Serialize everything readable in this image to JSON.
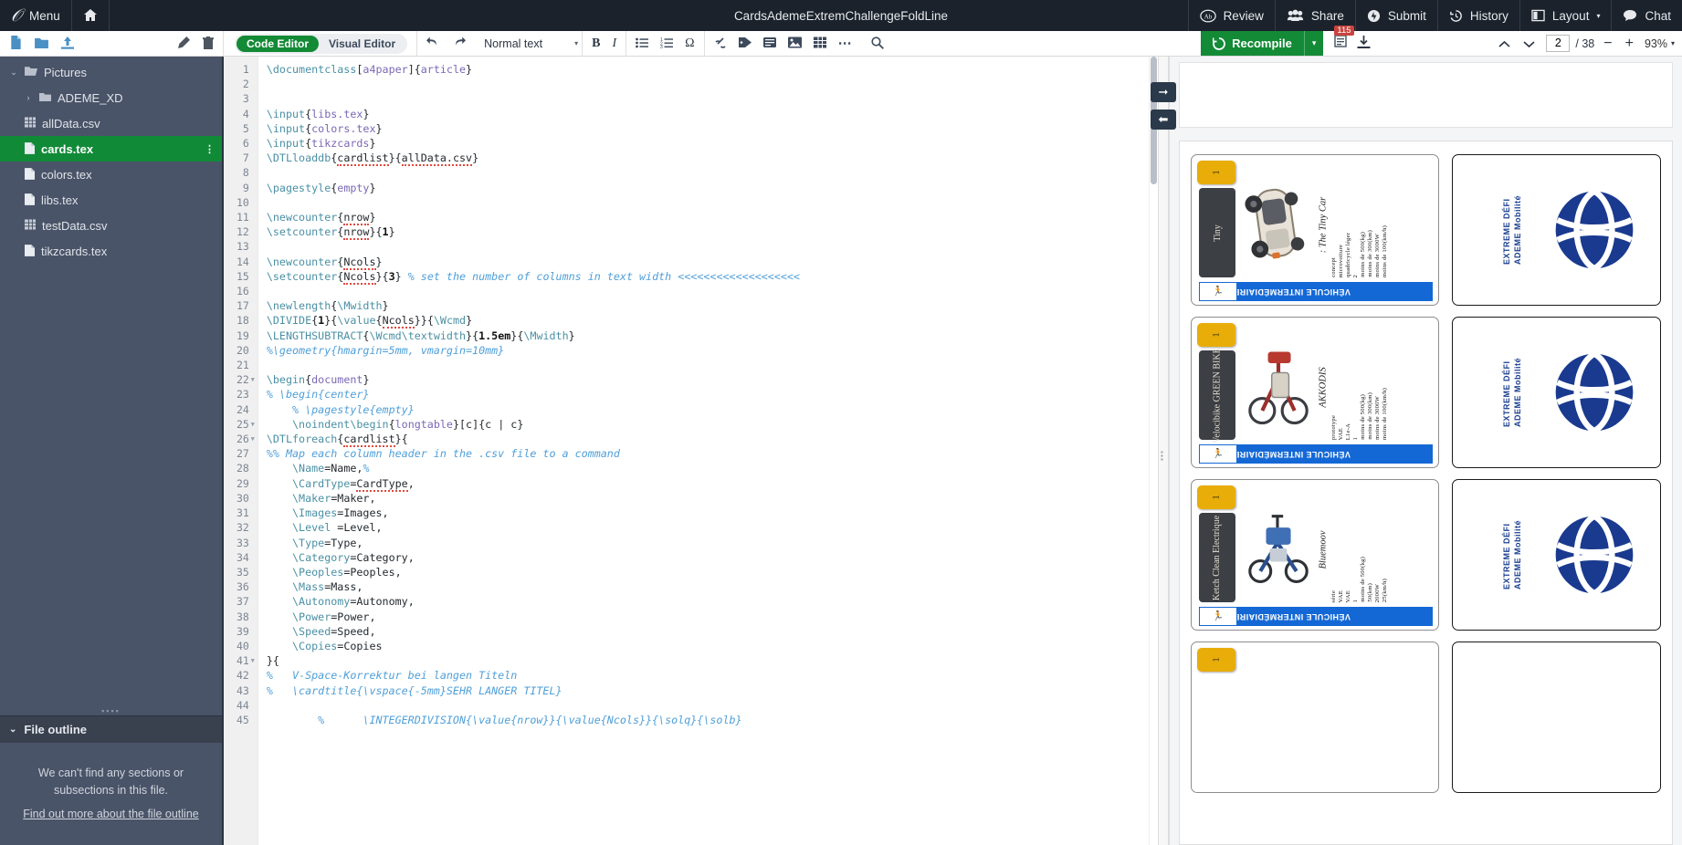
{
  "topnav": {
    "logo_icon": "overleaf-logo-icon",
    "menu_label": "Menu",
    "home_icon": "home-icon",
    "project_title": "CardsAdemeExtremChallengeFoldLine",
    "right_items": [
      {
        "label": "Review",
        "icon": "review-icon"
      },
      {
        "label": "Share",
        "icon": "share-people-icon"
      },
      {
        "label": "Submit",
        "icon": "submit-icon"
      },
      {
        "label": "History",
        "icon": "history-clock-icon"
      },
      {
        "label": "Layout",
        "icon": "layout-columns-icon",
        "caret": "▾"
      },
      {
        "label": "Chat",
        "icon": "chat-bubble-icon"
      }
    ]
  },
  "toolbar": {
    "left_icons": [
      "new-file-icon",
      "new-folder-icon",
      "upload-icon"
    ],
    "edit_icons": [
      "rename-pencil-icon",
      "delete-trash-icon"
    ],
    "editor_modes": [
      {
        "label": "Code Editor",
        "active": true
      },
      {
        "label": "Visual Editor",
        "active": false
      }
    ],
    "undo_icon": "undo-icon",
    "redo_icon": "redo-icon",
    "format_select": "Normal text",
    "format_caret": "▾",
    "bold_label": "B",
    "italic_label": "I",
    "list_icons": [
      "bullet-list-icon",
      "numbered-list-icon",
      "omega-symbol-icon"
    ],
    "insert_icons": [
      "link-icon",
      "tag-icon",
      "citation-icon",
      "image-icon",
      "table-icon"
    ],
    "more_icon": "ellipsis-icon",
    "search_icon": "search-icon",
    "recompile_label": "Recompile",
    "recompile_icon": "recompile-refresh-icon",
    "recompile_caret": "▾",
    "error_count": "115",
    "log_icon": "compile-log-icon",
    "download_icon": "download-pdf-icon",
    "page_prev_icon": "chevron-up-icon",
    "page_next_icon": "chevron-down-icon",
    "page_current": "2",
    "page_total": "/ 38",
    "zoom_out": "−",
    "zoom_in": "+",
    "zoom_level": "93%",
    "zoom_caret": "▾"
  },
  "sidebar": {
    "files": [
      {
        "name": "Pictures",
        "icon": "folder-open-icon",
        "caret": "⌄",
        "indent": false,
        "selected": false
      },
      {
        "name": "ADEME_XD",
        "icon": "folder-icon",
        "caret": "›",
        "indent": true,
        "selected": false
      },
      {
        "name": "allData.csv",
        "icon": "table-file-icon",
        "caret": "",
        "indent": false,
        "selected": false
      },
      {
        "name": "cards.tex",
        "icon": "tex-file-icon",
        "caret": "",
        "indent": false,
        "selected": true,
        "menu": "⋮"
      },
      {
        "name": "colors.tex",
        "icon": "tex-file-icon",
        "caret": "",
        "indent": false,
        "selected": false
      },
      {
        "name": "libs.tex",
        "icon": "tex-file-icon",
        "caret": "",
        "indent": false,
        "selected": false
      },
      {
        "name": "testData.csv",
        "icon": "table-file-icon",
        "caret": "",
        "indent": false,
        "selected": false
      },
      {
        "name": "tikzcards.tex",
        "icon": "tex-file-icon",
        "caret": "",
        "indent": false,
        "selected": false
      }
    ],
    "outline": {
      "header": "File outline",
      "caret": "⌄",
      "empty_line1": "We can't find any sections or",
      "empty_line2": "subsections in this file.",
      "link": "Find out more about the file outline"
    }
  },
  "editor": {
    "lines": [
      {
        "n": 1,
        "fold": false,
        "html": "<span class='cmd'>\\documentclass</span>[<span class='arg'>a4paper</span>]{<span class='arg'>article</span>}"
      },
      {
        "n": 2,
        "fold": false,
        "html": ""
      },
      {
        "n": 3,
        "fold": false,
        "html": ""
      },
      {
        "n": 4,
        "fold": false,
        "html": "<span class='cmd'>\\input</span>{<span class='arg'>libs.tex</span>}"
      },
      {
        "n": 5,
        "fold": false,
        "html": "<span class='cmd'>\\input</span>{<span class='arg'>colors.tex</span>}"
      },
      {
        "n": 6,
        "fold": false,
        "html": "<span class='cmd'>\\input</span>{<span class='arg'>tikzcards</span>}"
      },
      {
        "n": 7,
        "fold": false,
        "html": "<span class='cmd'>\\DTLloaddb</span>{<span class='sp'>cardlist</span>}{<span class='sp'>allData.csv</span>}"
      },
      {
        "n": 8,
        "fold": false,
        "html": ""
      },
      {
        "n": 9,
        "fold": false,
        "html": "<span class='cmd'>\\pagestyle</span>{<span class='arg'>empty</span>}"
      },
      {
        "n": 10,
        "fold": false,
        "html": ""
      },
      {
        "n": 11,
        "fold": false,
        "html": "<span class='cmd'>\\newcounter</span>{<span class='sp'>nrow</span>}"
      },
      {
        "n": 12,
        "fold": false,
        "html": "<span class='cmd'>\\setcounter</span>{<span class='sp'>nrow</span>}{<span class='num'>1</span>}"
      },
      {
        "n": 13,
        "fold": false,
        "html": ""
      },
      {
        "n": 14,
        "fold": false,
        "html": "<span class='cmd'>\\newcounter</span>{<span class='sp'>Ncols</span>}"
      },
      {
        "n": 15,
        "fold": false,
        "html": "<span class='cmd'>\\setcounter</span>{<span class='sp'>Ncols</span>}{<span class='num'>3</span>} <span class='cm'>% set the number of columns in text width &lt;&lt;&lt;&lt;&lt;&lt;&lt;&lt;&lt;&lt;&lt;&lt;&lt;&lt;&lt;&lt;&lt;&lt;&lt;</span>"
      },
      {
        "n": 16,
        "fold": false,
        "html": ""
      },
      {
        "n": 17,
        "fold": false,
        "html": "<span class='cmd'>\\newlength</span>{<span class='cmd'>\\Mwidth</span>}"
      },
      {
        "n": 18,
        "fold": false,
        "html": "<span class='cmd'>\\DIVIDE</span>{<span class='num'>1</span>}{<span class='cmd'>\\value</span>{<span class='sp'>Ncols</span>}}{<span class='cmd'>\\Wcmd</span>}"
      },
      {
        "n": 19,
        "fold": false,
        "html": "<span class='cmd'>\\LENGTHSUBTRACT</span>{<span class='cmd'>\\Wcmd\\textwidth</span>}{<span class='num'>1.5em</span>}{<span class='cmd'>\\Mwidth</span>}"
      },
      {
        "n": 20,
        "fold": false,
        "html": "<span class='cm'>%\\geometry{hmargin=5mm, vmargin=10mm}</span>"
      },
      {
        "n": 21,
        "fold": false,
        "html": ""
      },
      {
        "n": 22,
        "fold": true,
        "html": "<span class='cmd'>\\begin</span>{<span class='arg'>document</span>}"
      },
      {
        "n": 23,
        "fold": false,
        "html": "<span class='cm'>% \\begin{center}</span>"
      },
      {
        "n": 24,
        "fold": false,
        "html": "    <span class='cm'>% \\pagestyle{empty}</span>"
      },
      {
        "n": 25,
        "fold": true,
        "html": "    <span class='cmd'>\\noindent\\begin</span>{<span class='arg'>longtable</span>}[c]{c | c}"
      },
      {
        "n": 26,
        "fold": true,
        "html": "<span class='cmd'>\\DTLforeach</span>{<span class='sp'>cardlist</span>}{"
      },
      {
        "n": 27,
        "fold": false,
        "html": "<span class='cm'>%% Map each column header in the .csv file to a command</span>"
      },
      {
        "n": 28,
        "fold": false,
        "html": "    <span class='cmd'>\\Name</span>=Name,<span class='cm'>%</span>"
      },
      {
        "n": 29,
        "fold": false,
        "html": "    <span class='cmd'>\\CardType</span>=<span class='sp'>CardType</span>,"
      },
      {
        "n": 30,
        "fold": false,
        "html": "    <span class='cmd'>\\Maker</span>=Maker,"
      },
      {
        "n": 31,
        "fold": false,
        "html": "    <span class='cmd'>\\Images</span>=Images,"
      },
      {
        "n": 32,
        "fold": false,
        "html": "    <span class='cmd'>\\Level</span> =Level,"
      },
      {
        "n": 33,
        "fold": false,
        "html": "    <span class='cmd'>\\Type</span>=Type,"
      },
      {
        "n": 34,
        "fold": false,
        "html": "    <span class='cmd'>\\Category</span>=Category,"
      },
      {
        "n": 35,
        "fold": false,
        "html": "    <span class='cmd'>\\Peoples</span>=Peoples,"
      },
      {
        "n": 36,
        "fold": false,
        "html": "    <span class='cmd'>\\Mass</span>=Mass,"
      },
      {
        "n": 37,
        "fold": false,
        "html": "    <span class='cmd'>\\Autonomy</span>=Autonomy,"
      },
      {
        "n": 38,
        "fold": false,
        "html": "    <span class='cmd'>\\Power</span>=Power,"
      },
      {
        "n": 39,
        "fold": false,
        "html": "    <span class='cmd'>\\Speed</span>=Speed,"
      },
      {
        "n": 40,
        "fold": false,
        "html": "    <span class='cmd'>\\Copies</span>=Copies"
      },
      {
        "n": 41,
        "fold": true,
        "html": "}{"
      },
      {
        "n": 42,
        "fold": false,
        "html": "<span class='cm'>%   V-Space-Korrektur bei langen Titeln</span>"
      },
      {
        "n": 43,
        "fold": false,
        "html": "<span class='cm'>%   \\cardtitle{\\vspace{-5mm}SEHR LANGER TITEL}</span>"
      },
      {
        "n": 44,
        "fold": false,
        "html": ""
      },
      {
        "n": 45,
        "fold": false,
        "html": "        <span class='cm'>%      \\INTEGERDIVISION{\\value{nrow}}{\\value{Ncols}}{\\solq}{\\solb}</span>"
      }
    ]
  },
  "preview": {
    "cards": [
      {
        "number": "1",
        "name": "Tiny",
        "title": ": The Tiny Car",
        "specs": [
          "concept",
          "microvoiture",
          "quadricycle léger",
          "2",
          "moins de 500(kg)",
          "moins de 300(km)",
          "moins de 3000W",
          "moins de 100(km/h)"
        ],
        "footer": "VÉHICULE INTERMÉDIAIRE",
        "image_icon": "tiny-car-image"
      },
      {
        "number": "1",
        "name": "Velocibike GREEN BIKE",
        "title": "AKKODIS",
        "specs": [
          "prototype",
          "VAE",
          "L1e-A",
          "1",
          "moins de 500(kg)",
          "moins de 300(km)",
          "moins de 3000W",
          "moins de 100(km/h)"
        ],
        "footer": "VÉHICULE INTERMÉDIAIRE",
        "image_icon": "green-bike-image"
      },
      {
        "number": "1",
        "name": "Ketch Clean Electrique",
        "title": "Bluemoov",
        "specs": [
          "série",
          "VAE",
          "VAE",
          "1",
          "moins de 500(kg)",
          "50(km)",
          "2000W",
          "25(km/h)"
        ],
        "footer": "VÉHICULE INTERMÉDIAIRE",
        "image_icon": "ketch-clean-image"
      },
      {
        "number": "1",
        "name": "",
        "title": "",
        "specs": [],
        "footer": "",
        "image_icon": "partial-card-image"
      }
    ],
    "back_cards": [
      {
        "line1": "EXTREME DÉFI",
        "line2": "ADEME Mobilité",
        "logo_icon": "ademe-logo-icon"
      },
      {
        "line1": "EXTREME DÉFI",
        "line2": "ADEME Mobilité",
        "logo_icon": "ademe-logo-icon"
      },
      {
        "line1": "EXTREME DÉFI",
        "line2": "ADEME Mobilité",
        "logo_icon": "ademe-logo-icon"
      },
      {
        "line1": "",
        "line2": "",
        "logo_icon": "ademe-logo-icon"
      }
    ],
    "colors": {
      "tab_yellow": "#e8ad09",
      "footer_blue": "#1468d6",
      "logo_blue": "#1a3a8f",
      "name_dark": "#3c3f44"
    }
  }
}
